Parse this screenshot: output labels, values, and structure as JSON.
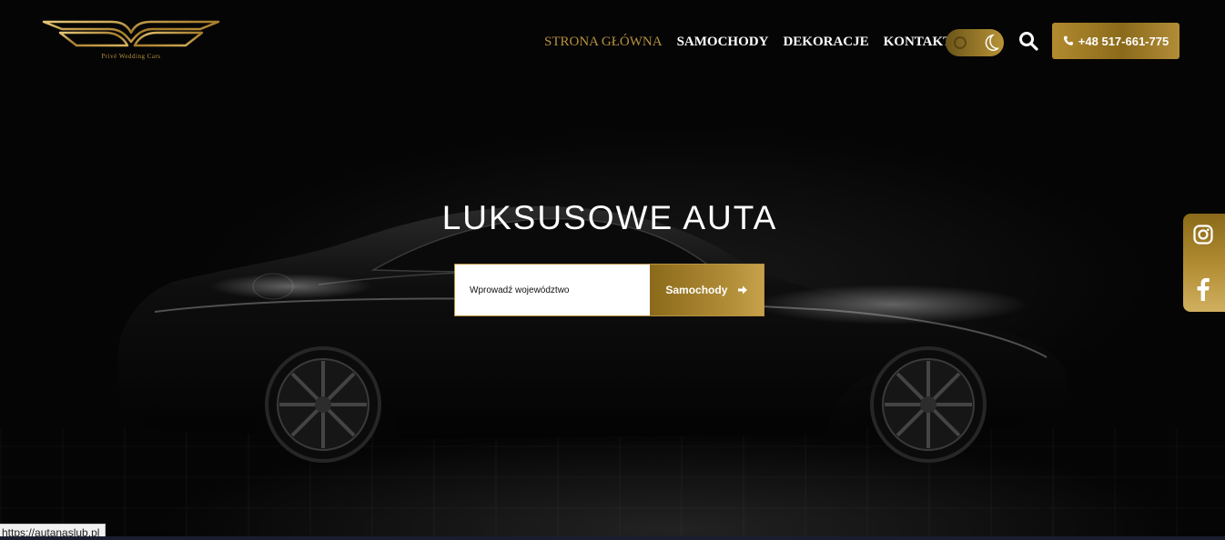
{
  "logo": {
    "tagline": "Privé Wedding Cars"
  },
  "nav": {
    "items": [
      {
        "label": "STRONA GŁÓWNA",
        "active": true
      },
      {
        "label": "SAMOCHODY",
        "active": false
      },
      {
        "label": "DEKORACJE",
        "active": false
      },
      {
        "label": "KONTAKT",
        "active": false
      }
    ]
  },
  "header": {
    "phone_label": "+48 517-661-775",
    "theme": "dark"
  },
  "hero": {
    "title": "LUKSUSOWE AUTA",
    "search_placeholder": "Wprowadź województwo",
    "search_value": "",
    "button_label": "Samochody"
  },
  "social": {
    "icons": [
      "instagram-icon",
      "facebook-icon"
    ]
  },
  "status_bar": {
    "url": "https://autanaslub.pl"
  },
  "colors": {
    "gold": "#b8913e",
    "background": "#000000",
    "text": "#ffffff"
  }
}
